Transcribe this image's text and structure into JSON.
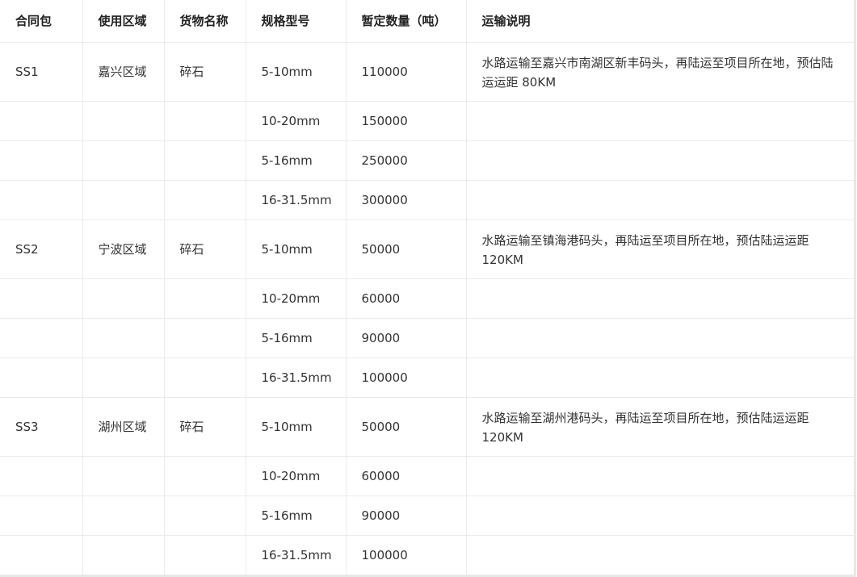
{
  "table": {
    "headers": [
      "合同包",
      "使用区域",
      "货物名称",
      "规格型号",
      "暂定数量（吨）",
      "运输说明"
    ],
    "rows": [
      [
        "SS1",
        "嘉兴区域",
        "碎石",
        "5-10mm",
        "110000",
        "水路运输至嘉兴市南湖区新丰码头，再陆运至项目所在地，预估陆运运距 80KM"
      ],
      [
        "",
        "",
        "",
        "10-20mm",
        "150000",
        ""
      ],
      [
        "",
        "",
        "",
        "5-16mm",
        "250000",
        ""
      ],
      [
        "",
        "",
        "",
        "16-31.5mm",
        "300000",
        ""
      ],
      [
        "SS2",
        "宁波区域",
        "碎石",
        "5-10mm",
        "50000",
        "水路运输至镇海港码头，再陆运至项目所在地，预估陆运运距 120KM"
      ],
      [
        "",
        "",
        "",
        "10-20mm",
        "60000",
        ""
      ],
      [
        "",
        "",
        "",
        "5-16mm",
        "90000",
        ""
      ],
      [
        "",
        "",
        "",
        "16-31.5mm",
        "100000",
        ""
      ],
      [
        "SS3",
        "湖州区域",
        "碎石",
        "5-10mm",
        "50000",
        "水路运输至湖州港码头，再陆运至项目所在地，预估陆运运距 120KM"
      ],
      [
        "",
        "",
        "",
        "10-20mm",
        "60000",
        ""
      ],
      [
        "",
        "",
        "",
        "5-16mm",
        "90000",
        ""
      ],
      [
        "",
        "",
        "",
        "16-31.5mm",
        "100000",
        ""
      ]
    ]
  }
}
